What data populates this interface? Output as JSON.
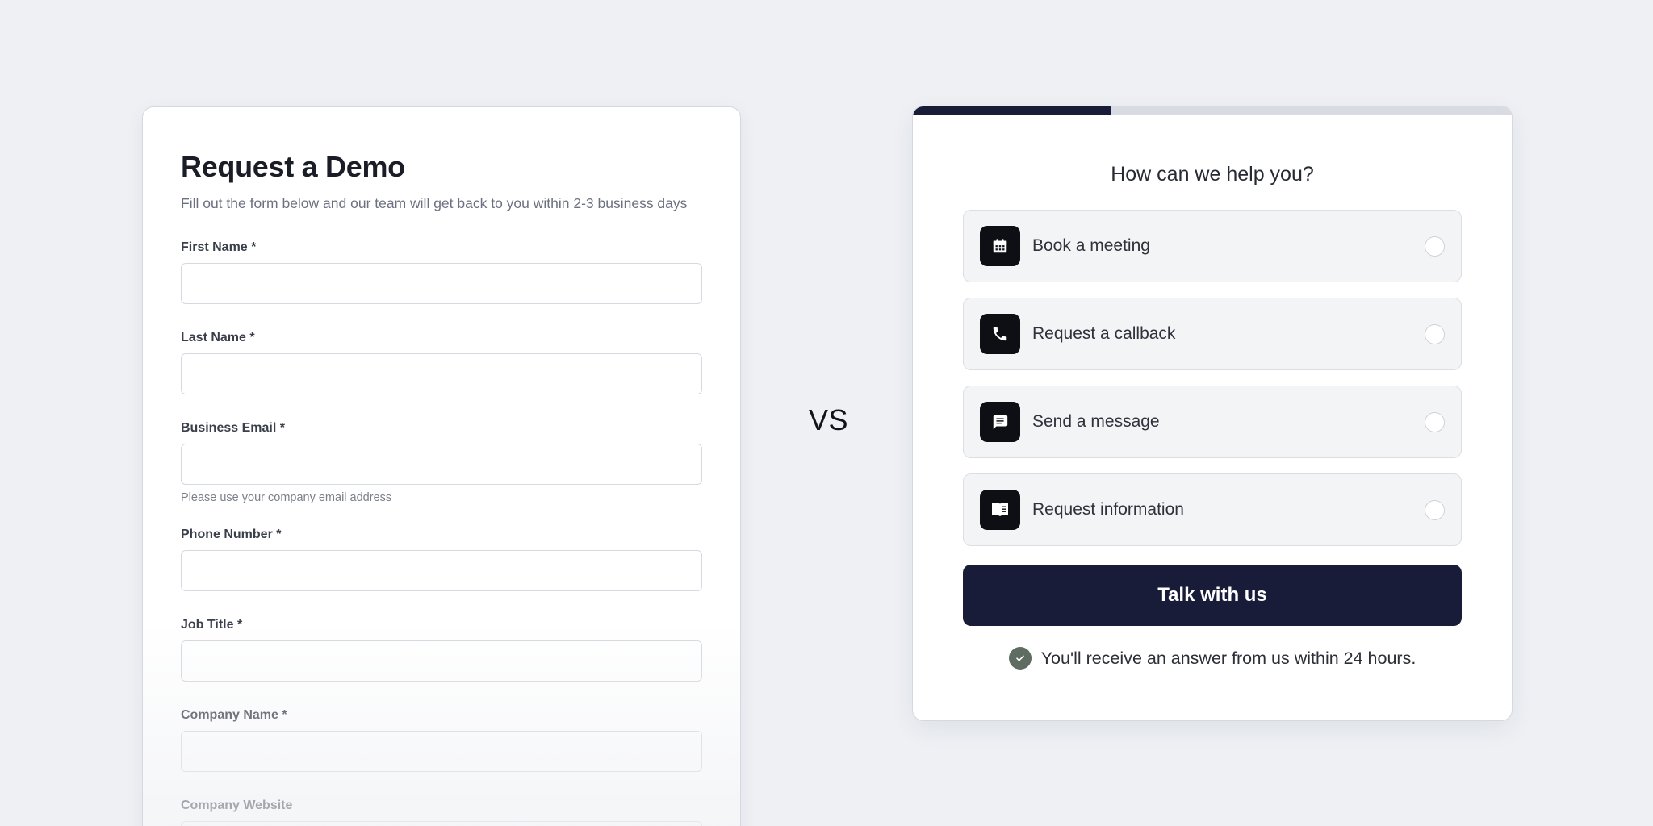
{
  "form": {
    "title": "Request a Demo",
    "subtitle": "Fill out the form below and our team will get back to you within 2-3 business days",
    "fields": [
      {
        "label": "First Name *"
      },
      {
        "label": "Last Name *"
      },
      {
        "label": "Business Email *",
        "help": "Please use your company email address"
      },
      {
        "label": "Phone Number *"
      },
      {
        "label": "Job Title *"
      },
      {
        "label": "Company Name *"
      },
      {
        "label": "Company Website"
      }
    ]
  },
  "separator": {
    "text": "VS"
  },
  "help": {
    "progress": 0.33,
    "title": "How can we help you?",
    "options": [
      {
        "label": "Book a meeting",
        "icon": "calendar-icon"
      },
      {
        "label": "Request a callback",
        "icon": "phone-icon"
      },
      {
        "label": "Send a message",
        "icon": "chat-icon"
      },
      {
        "label": "Request information",
        "icon": "book-icon"
      }
    ],
    "cta_label": "Talk with us",
    "note": "You'll receive an answer from us within 24 hours."
  },
  "colors": {
    "background": "#eef0f4",
    "primary": "#181c38",
    "icon_tile": "#0e0f14",
    "check": "#5f6c62"
  }
}
